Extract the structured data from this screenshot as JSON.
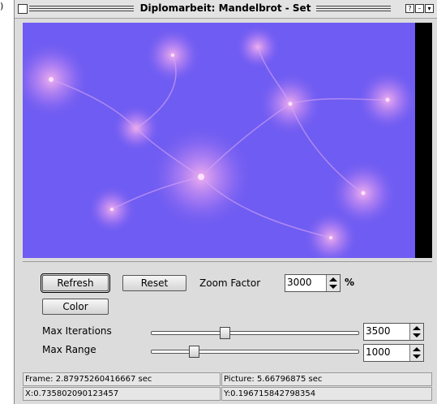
{
  "window": {
    "title": "Diplomarbeit: Mandelbrot - Set"
  },
  "canvas": {
    "icon": "mandelbrot-fractal-image"
  },
  "controls": {
    "refresh_label": "Refresh",
    "reset_label": "Reset",
    "color_label": "Color",
    "zoom_label": "Zoom Factor",
    "zoom_value": "3000",
    "zoom_unit": "%",
    "max_iterations_label": "Max Iterations",
    "max_iterations_value": "3500",
    "max_iterations_slider": 0.36,
    "max_range_label": "Max Range",
    "max_range_value": "1000",
    "max_range_slider": 0.2
  },
  "status": {
    "frame": "Frame: 2.87975260416667 sec",
    "picture": "Picture: 5.66796875 sec",
    "x": "X:0.735802090123457",
    "y": "Y:0.196715842798354"
  },
  "colors": {
    "fractal_bg": "#6f5cf2",
    "fractal_glow": "#f0a0f0"
  }
}
